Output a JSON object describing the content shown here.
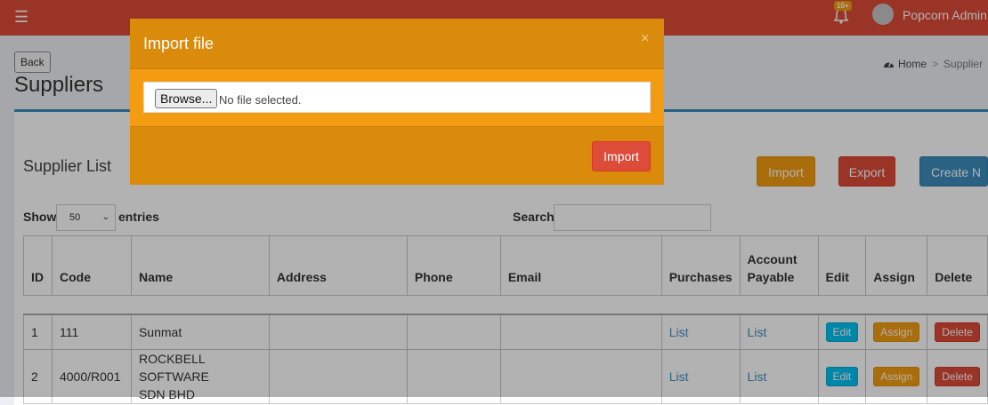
{
  "navbar": {
    "menu_icon": "hamburger-icon",
    "notification_icon": "bell-icon",
    "notification_badge": "10+",
    "user_name": "Popcorn Admin",
    "brand_color": "#dd4b39"
  },
  "page": {
    "back_label": "Back",
    "title": "Suppliers",
    "breadcrumb": {
      "home_icon": "dashboard-icon",
      "home": "Home",
      "separator": ">",
      "current": "Supplier"
    }
  },
  "box": {
    "title": "Supplier List",
    "import_label": "Import",
    "export_label": "Export",
    "create_label": "Create N"
  },
  "table_controls": {
    "show_label": "Show",
    "entries_value": "50",
    "entries_label": "entries",
    "search_label": "Search:",
    "search_value": ""
  },
  "table": {
    "headers": [
      {
        "line1": "ID",
        "line2": ""
      },
      {
        "line1": "Code",
        "line2": ""
      },
      {
        "line1": "Name",
        "line2": ""
      },
      {
        "line1": "Address",
        "line2": ""
      },
      {
        "line1": "Phone",
        "line2": ""
      },
      {
        "line1": "Email",
        "line2": ""
      },
      {
        "line1": "Purchases",
        "line2": ""
      },
      {
        "line1": "Account",
        "line2": "Payable"
      },
      {
        "line1": "Edit",
        "line2": ""
      },
      {
        "line1": "Assign",
        "line2": ""
      },
      {
        "line1": "Delete",
        "line2": ""
      }
    ],
    "rows": [
      {
        "id": "1",
        "code": "111",
        "name": "Sunmat",
        "name2": "",
        "address": "",
        "phone": "",
        "email": "",
        "purchases": "List",
        "account_payable": "List",
        "edit": "Edit",
        "assign": "Assign",
        "delete": "Delete"
      },
      {
        "id": "2",
        "code": "4000/R001",
        "name": "ROCKBELL SOFTWARE",
        "name2": "SDN BHD",
        "address": "",
        "phone": "",
        "email": "",
        "purchases": "List",
        "account_payable": "List",
        "edit": "Edit",
        "assign": "Assign",
        "delete": "Delete"
      }
    ]
  },
  "modal": {
    "title": "Import file",
    "close_icon": "close-icon",
    "browse_label": "Browse...",
    "file_status": "No file selected.",
    "import_label": "Import",
    "color": "#f39c12"
  }
}
